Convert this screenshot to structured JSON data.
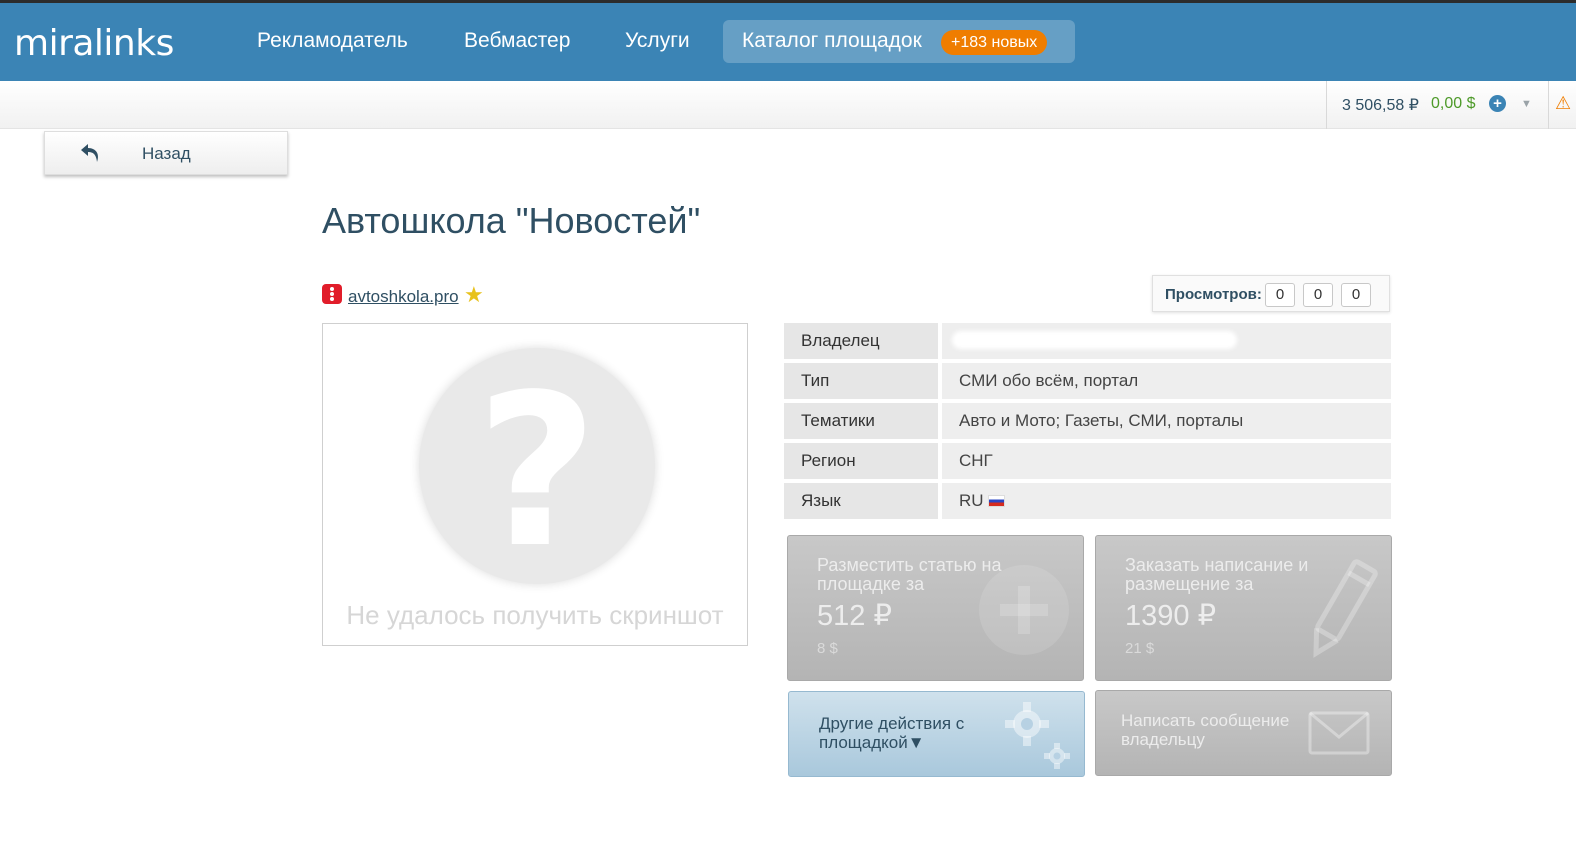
{
  "brand": {
    "logo": "miralinks"
  },
  "nav": {
    "items": [
      "Рекламодатель",
      "Вебмастер",
      "Услуги"
    ],
    "catalog": {
      "label": "Каталог площадок",
      "badge": "+183 новых"
    }
  },
  "balance": {
    "rub": "3 506,58 ₽",
    "usd": "0,00 $",
    "warning_icon": "warning-icon"
  },
  "back_button": {
    "label": "Назад",
    "icon": "undo-arrow-icon"
  },
  "page": {
    "title": "Автошкола \"Новостей\""
  },
  "site": {
    "domain": "avtoshkola.pro",
    "favorite_icon": "star-icon"
  },
  "views": {
    "label": "Просмотров:",
    "counts": [
      "0",
      "0",
      "0"
    ]
  },
  "screenshot": {
    "error_text": "Не удалось получить скриншот",
    "placeholder_icon": "question-mark-icon"
  },
  "info": {
    "rows": [
      {
        "key": "Владелец",
        "value": ""
      },
      {
        "key": "Тип",
        "value": "СМИ обо всём, портал"
      },
      {
        "key": "Тематики",
        "value": "Авто и Мото; Газеты, СМИ, порталы"
      },
      {
        "key": "Регион",
        "value": "СНГ"
      },
      {
        "key": "Язык",
        "value": "RU"
      }
    ]
  },
  "actions": {
    "place_article": {
      "title": "Разместить статью на площадке за",
      "price": "512 ₽",
      "usd": "8 $",
      "icon": "plus-icon"
    },
    "order_writing": {
      "title": "Заказать написание и размещение за",
      "price": "1390 ₽",
      "usd": "21 $",
      "icon": "pencil-icon"
    },
    "other_actions": {
      "label": "Другие действия с площадкой▼",
      "icon": "gears-icon"
    },
    "message_owner": {
      "label": "Написать сообщение владельцу",
      "icon": "envelope-icon"
    }
  },
  "colors": {
    "header": "#3b84b5",
    "badge": "#ef7d00",
    "title": "#2f4f63",
    "usd_balance": "#4d9a29"
  }
}
